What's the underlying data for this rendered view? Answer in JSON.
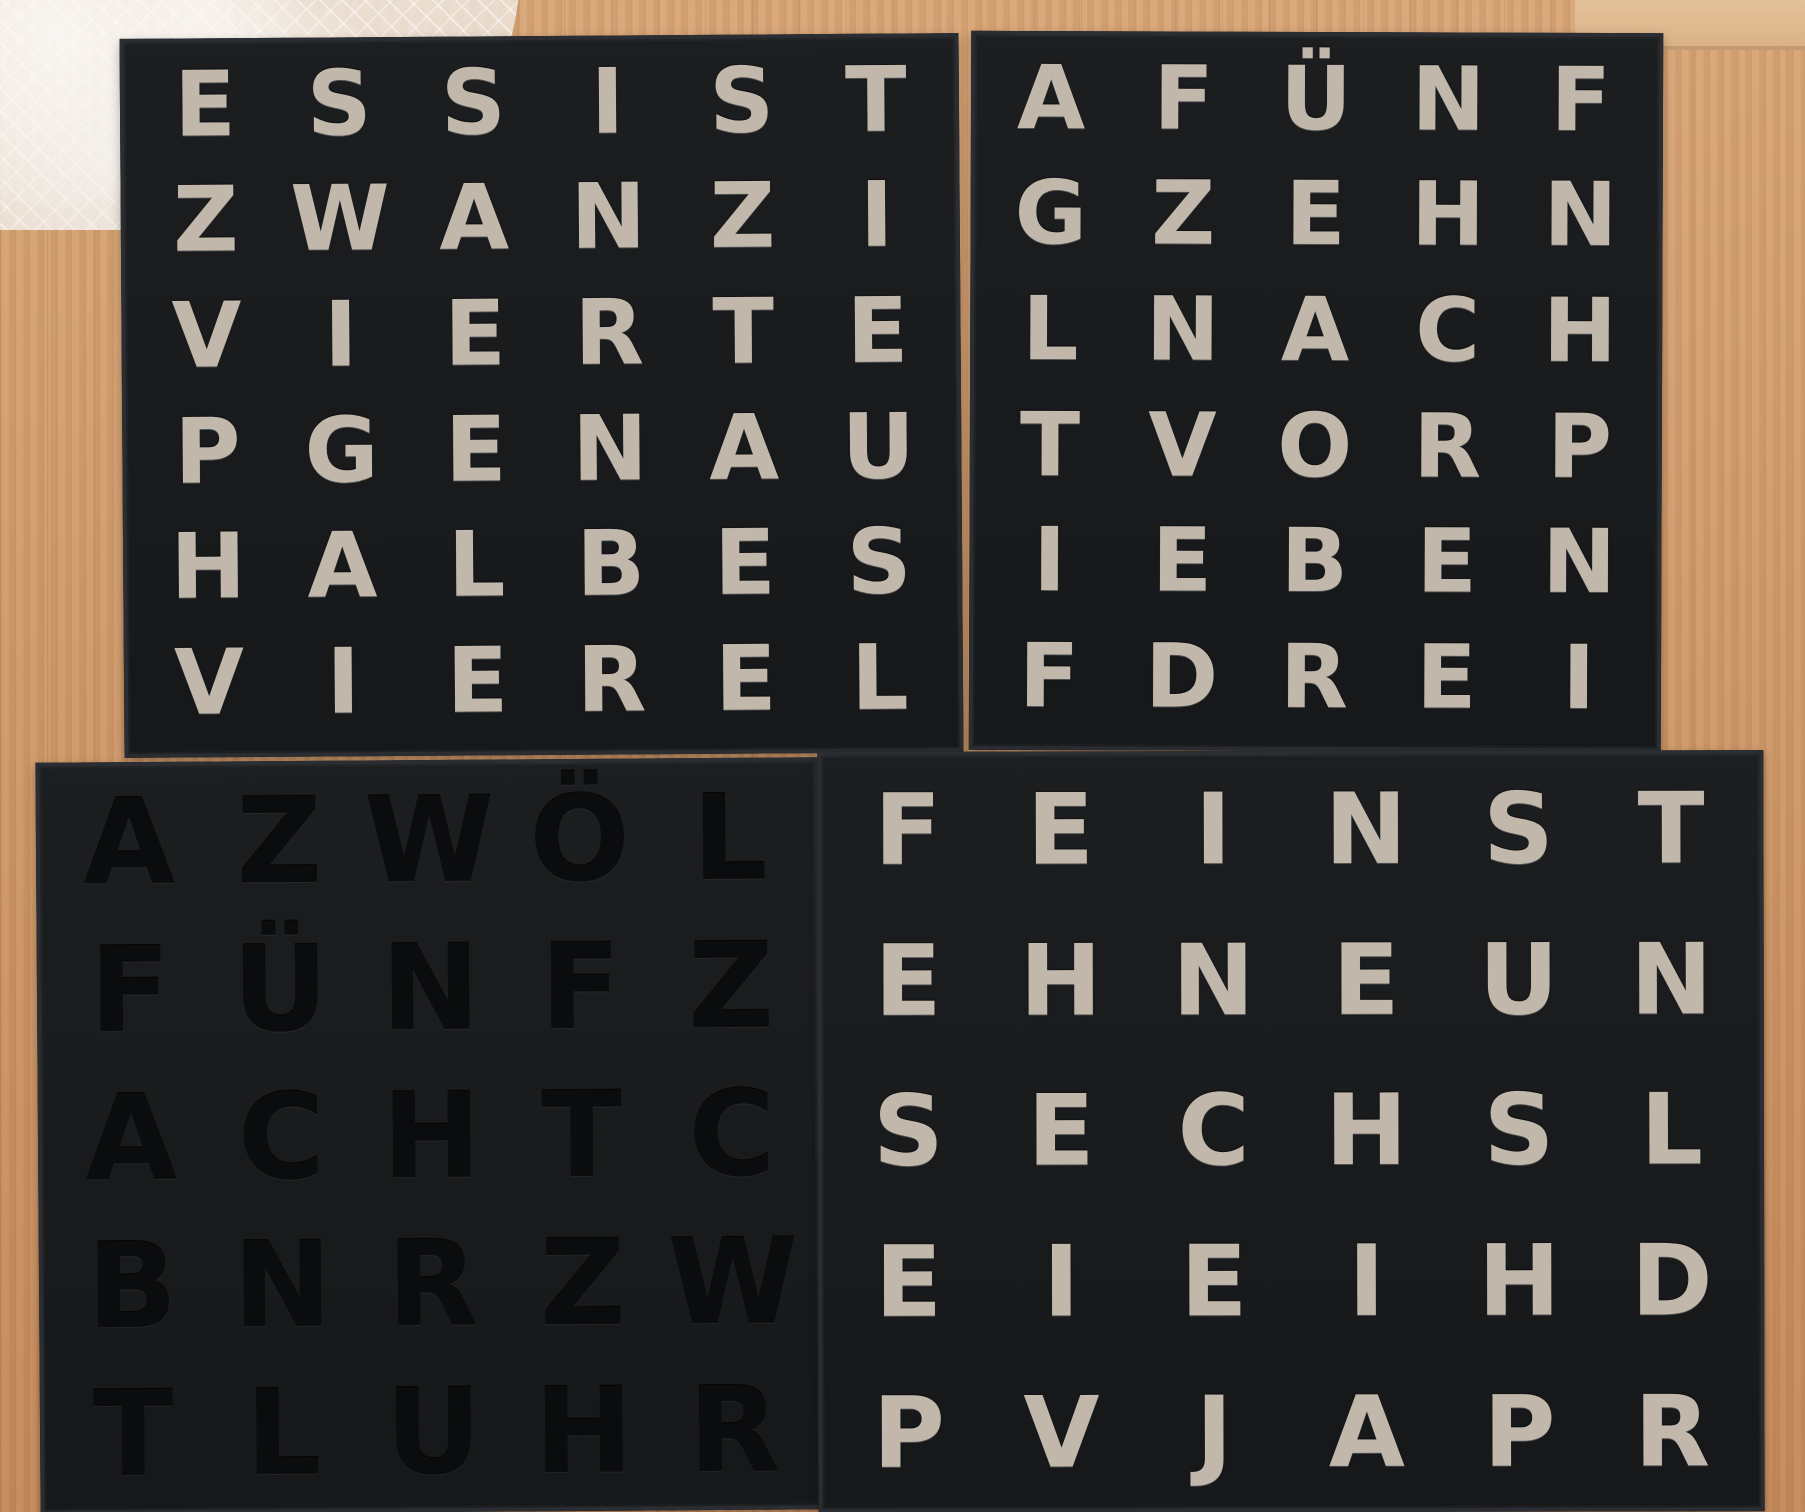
{
  "colors": {
    "background_wood": "#cf9a6b",
    "panel": "#17191b",
    "light_letters": "#c1b7aa",
    "dark_letters": "#0b0c0d",
    "cloth": "#f1ede6"
  },
  "panels": {
    "top_left": [
      "E",
      "S",
      "S",
      "I",
      "S",
      "T",
      "Z",
      "W",
      "A",
      "N",
      "Z",
      "I",
      "V",
      "I",
      "E",
      "R",
      "T",
      "E",
      "P",
      "G",
      "E",
      "N",
      "A",
      "U",
      "H",
      "A",
      "L",
      "B",
      "E",
      "S",
      "V",
      "I",
      "E",
      "R",
      "E",
      "L"
    ],
    "top_right": [
      "A",
      "F",
      "Ü",
      "N",
      "F",
      "G",
      "Z",
      "E",
      "H",
      "N",
      "L",
      "N",
      "A",
      "C",
      "H",
      "T",
      "V",
      "O",
      "R",
      "P",
      "I",
      "E",
      "B",
      "E",
      "N",
      "F",
      "D",
      "R",
      "E",
      "I"
    ],
    "bottom_left": [
      "A",
      "Z",
      "W",
      "Ö",
      "L",
      "F",
      "Ü",
      "N",
      "F",
      "Z",
      "A",
      "C",
      "H",
      "T",
      "C",
      "B",
      "N",
      "R",
      "Z",
      "W",
      "T",
      "L",
      "U",
      "H",
      "R"
    ],
    "bottom_right": [
      "F",
      "E",
      "I",
      "N",
      "S",
      "T",
      "E",
      "H",
      "N",
      "E",
      "U",
      "N",
      "S",
      "E",
      "C",
      "H",
      "S",
      "L",
      "E",
      "I",
      "E",
      "I",
      "H",
      "D",
      "P",
      "V",
      "J",
      "A",
      "P",
      "R"
    ]
  }
}
